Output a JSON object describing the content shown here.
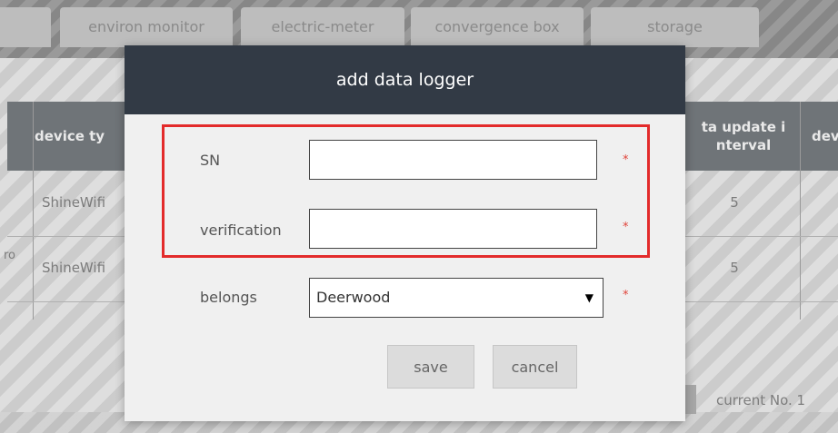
{
  "tabs": [
    {
      "label": ""
    },
    {
      "label": "environ monitor"
    },
    {
      "label": "electric-meter"
    },
    {
      "label": "convergence box"
    },
    {
      "label": "storage"
    }
  ],
  "table": {
    "headers": {
      "device_type": "device ty",
      "update_interval_line1": "ta update i",
      "update_interval_line2": "nterval",
      "dev": "dev"
    },
    "rows": [
      {
        "edge": "",
        "device_type": "ShineWifi",
        "update_interval": "5"
      },
      {
        "edge": "ro",
        "device_type": "ShineWifi",
        "update_interval": "5"
      }
    ]
  },
  "pager": {
    "text": "current  No. 1"
  },
  "modal": {
    "title": "add data logger",
    "fields": {
      "sn": {
        "label": "SN",
        "value": "",
        "required_mark": "*"
      },
      "verification": {
        "label": "verification",
        "value": "",
        "required_mark": "*"
      },
      "belongs": {
        "label": "belongs",
        "selected": "Deerwood",
        "required_mark": "*",
        "arrow": "▼"
      }
    },
    "buttons": {
      "save": "save",
      "cancel": "cancel"
    },
    "highlight_color": "#e32b2b"
  },
  "colors": {
    "modal_header": "#323a45",
    "table_header": "#6f7478",
    "required": "#e0443a"
  }
}
